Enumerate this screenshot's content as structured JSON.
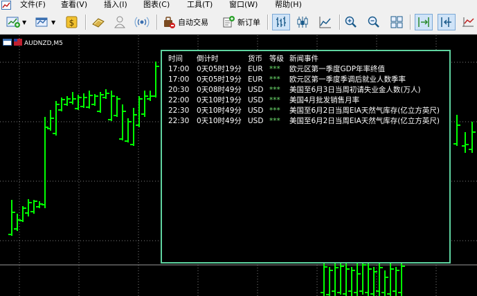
{
  "menu": [
    "文件(F)",
    "查看(V)",
    "插入(I)",
    "图表(C)",
    "工具(T)",
    "窗口(W)",
    "帮助(H)"
  ],
  "toolbar": {
    "auto_trade_label": "自动交易",
    "new_order_label": "新订单"
  },
  "chart": {
    "symbol_label": "AUDNZD,M5",
    "bar_color": "#00ff00",
    "grid_color": "#808080"
  },
  "news_panel": {
    "border_color": "#5fd4a0",
    "headers": {
      "time": "时间",
      "countdown": "倒计时",
      "currency": "货币",
      "level": "等级",
      "event": "新闻事件"
    },
    "rows": [
      {
        "time": "17:00",
        "countdown": "0天05时19分",
        "currency": "EUR",
        "level": "***",
        "event": "欧元区第一季度GDP年率终值"
      },
      {
        "time": "17:00",
        "countdown": "0天05时19分",
        "currency": "EUR",
        "level": "***",
        "event": "欧元区第一季度季调后就业人数季率"
      },
      {
        "time": "20:30",
        "countdown": "0天08时49分",
        "currency": "USD",
        "level": "***",
        "event": "美国至6月3日当周初请失业金人数(万人)"
      },
      {
        "time": "22:00",
        "countdown": "0天10时19分",
        "currency": "USD",
        "level": "***",
        "event": "美国4月批发销售月率"
      },
      {
        "time": "22:30",
        "countdown": "0天10时49分",
        "currency": "USD",
        "level": "***",
        "event": "美国至6月2日当周EIA天然气库存(亿立方英尺)"
      },
      {
        "time": "22:30",
        "countdown": "0天10时49分",
        "currency": "USD",
        "level": "***",
        "event": "美国至6月2日当周EIA天然气库存(亿立方英尺)"
      }
    ]
  }
}
